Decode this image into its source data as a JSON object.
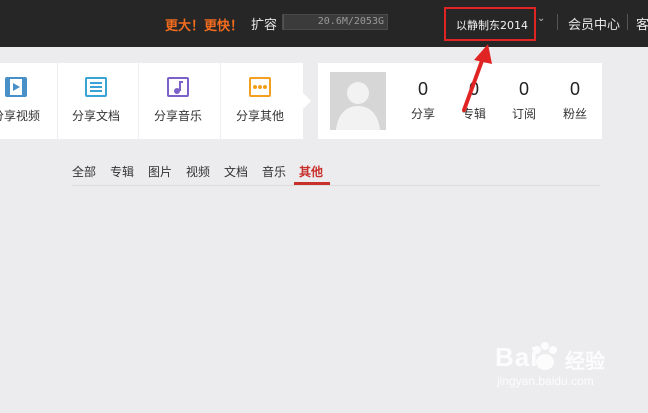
{
  "topbar": {
    "promo": "更大！更快！",
    "expand_label": "扩容",
    "storage_text": "20.6M/2053G",
    "storage_fraction": 0.01,
    "username": "以静制东2014",
    "member_center": "会员中心",
    "service": "客"
  },
  "share": {
    "items": [
      {
        "label": "分享视频",
        "icon": "video-icon",
        "color": "#4a90c8"
      },
      {
        "label": "分享文档",
        "icon": "document-icon",
        "color": "#3aa3d6"
      },
      {
        "label": "分享音乐",
        "icon": "music-icon",
        "color": "#7b61c9"
      },
      {
        "label": "分享其他",
        "icon": "more-icon",
        "color": "#f2a01e"
      }
    ]
  },
  "stats": {
    "items": [
      {
        "value": "0",
        "label": "分享"
      },
      {
        "value": "0",
        "label": "专辑"
      },
      {
        "value": "0",
        "label": "订阅"
      },
      {
        "value": "0",
        "label": "粉丝"
      }
    ]
  },
  "tabs": [
    "全部",
    "专辑",
    "图片",
    "视频",
    "文档",
    "音乐",
    "其他"
  ],
  "active_tab": "其他",
  "watermark": {
    "brand": "Bai",
    "brand_cn": "经验",
    "url": "jingyan.baidu.com"
  },
  "colors": {
    "topbar": "#262626",
    "promo": "#f26c1f",
    "accent": "#c8302b",
    "highlight_box": "#e02424"
  }
}
